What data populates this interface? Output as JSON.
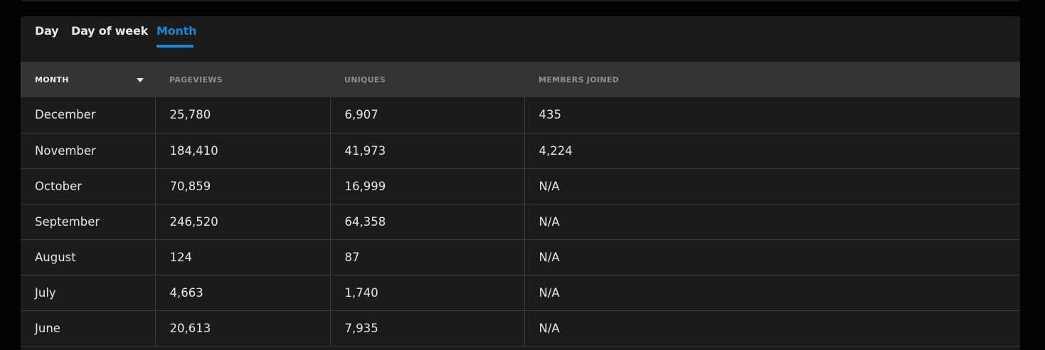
{
  "tabs": [
    {
      "label": "Day",
      "active": false
    },
    {
      "label": "Day of week",
      "active": false
    },
    {
      "label": "Month",
      "active": true
    }
  ],
  "accent_color": "#1e86d8",
  "table": {
    "columns": [
      "MONTH",
      "PAGEVIEWS",
      "UNIQUES",
      "MEMBERS JOINED"
    ],
    "sorted_column": "MONTH",
    "sort_icon": "caret-down-icon",
    "rows": [
      {
        "month": "December",
        "pageviews": "25,780",
        "uniques": "6,907",
        "members_joined": "435"
      },
      {
        "month": "November",
        "pageviews": "184,410",
        "uniques": "41,973",
        "members_joined": "4,224"
      },
      {
        "month": "October",
        "pageviews": "70,859",
        "uniques": "16,999",
        "members_joined": "N/A"
      },
      {
        "month": "September",
        "pageviews": "246,520",
        "uniques": "64,358",
        "members_joined": "N/A"
      },
      {
        "month": "August",
        "pageviews": "124",
        "uniques": "87",
        "members_joined": "N/A"
      },
      {
        "month": "July",
        "pageviews": "4,663",
        "uniques": "1,740",
        "members_joined": "N/A"
      },
      {
        "month": "June",
        "pageviews": "20,613",
        "uniques": "7,935",
        "members_joined": "N/A"
      }
    ]
  }
}
